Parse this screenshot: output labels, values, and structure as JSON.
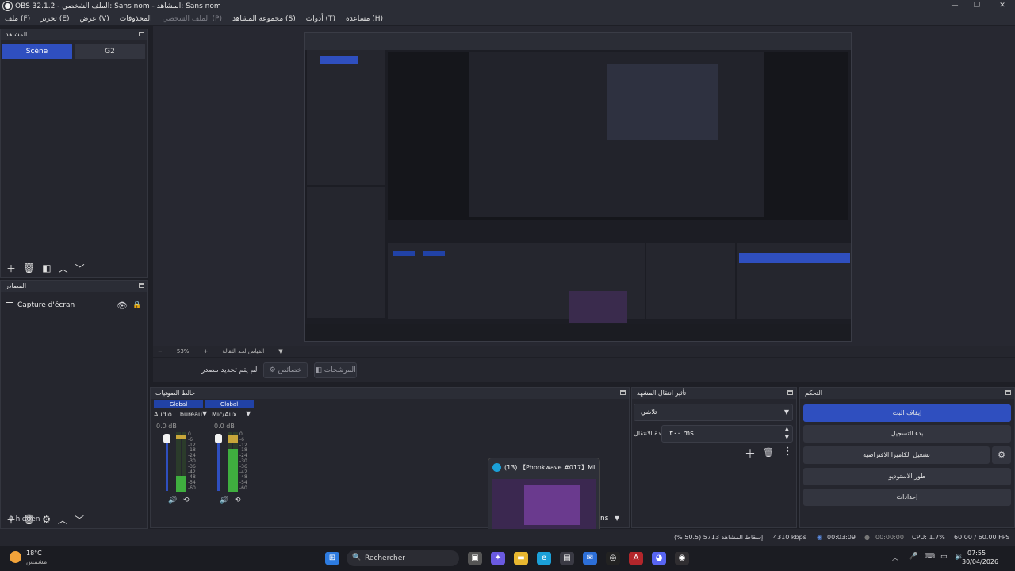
{
  "app": {
    "title": "OBS 32.1.2 - الملف الشخصي: Sans nom - المشاهد: Sans nom",
    "window_controls": [
      "—",
      "❐",
      "✕"
    ]
  },
  "menu": {
    "items": [
      "ملف (F)",
      "تحرير (E)",
      "عرض (V)",
      "المحذوفات",
      "الملف الشخصي (P)",
      "مجموعة المشاهد (S)",
      "أدوات (T)",
      "مساعدة (H)"
    ]
  },
  "scenes": {
    "title": "المشاهد",
    "items": [
      "Scène",
      "G2"
    ],
    "selected": "Scène"
  },
  "sources": {
    "title": "المصادر",
    "items": [
      {
        "label": "Capture d'écran"
      }
    ]
  },
  "preview": {
    "zoom": "53%",
    "zoom_label": "القياس لحد الثقالة"
  },
  "context_bar": {
    "no_source": "لم يتم تحديد مصدر",
    "properties": "خصائص",
    "filters": "المرشحات"
  },
  "mixer": {
    "title": "خالط الصوتيات",
    "tracks": [
      {
        "header": "Global",
        "name": "Audio ...bureau",
        "db": "0.0 dB"
      },
      {
        "header": "Global",
        "name": "Mic/Aux",
        "db": "0.0 dB"
      }
    ],
    "scale": [
      "0",
      "-6",
      "-12",
      "-18",
      "-24",
      "-30",
      "-36",
      "-42",
      "-48",
      "-54",
      "-60"
    ],
    "hidden": "0 hidden",
    "partial_label": "ns"
  },
  "transition": {
    "title": "تأثير انتقال المشهد",
    "selected": "تلاشي",
    "duration_label": "مدة الانتقال",
    "duration_value": "٣٠٠ ms"
  },
  "controls": {
    "title": "التحكم",
    "buttons": [
      "إيقاف البث",
      "بدء التسجيل",
      "تشغيل الكاميرا الافتراضية",
      "طور الاستوديو",
      "إعدادات"
    ]
  },
  "thumbnail": {
    "title": "(13) 【Phonkwave #017】MI..."
  },
  "status": {
    "dropped": "إسقاط المشاهد 5713 (50.5 %)",
    "bitrate": "4310 kbps",
    "stream_time": "00:03:09",
    "rec_time": "00:00:00",
    "cpu": "CPU: 1.7%",
    "fps": "60.00 / 60.00 FPS"
  },
  "taskbar": {
    "weather_temp": "18°C",
    "weather_desc": "مشمس",
    "search": "Rechercher",
    "time": "07:55",
    "date": "30/04/2026"
  },
  "colors": {
    "accent": "#2f4fbf",
    "panel": "#25262e",
    "background": "#1e1f26"
  }
}
